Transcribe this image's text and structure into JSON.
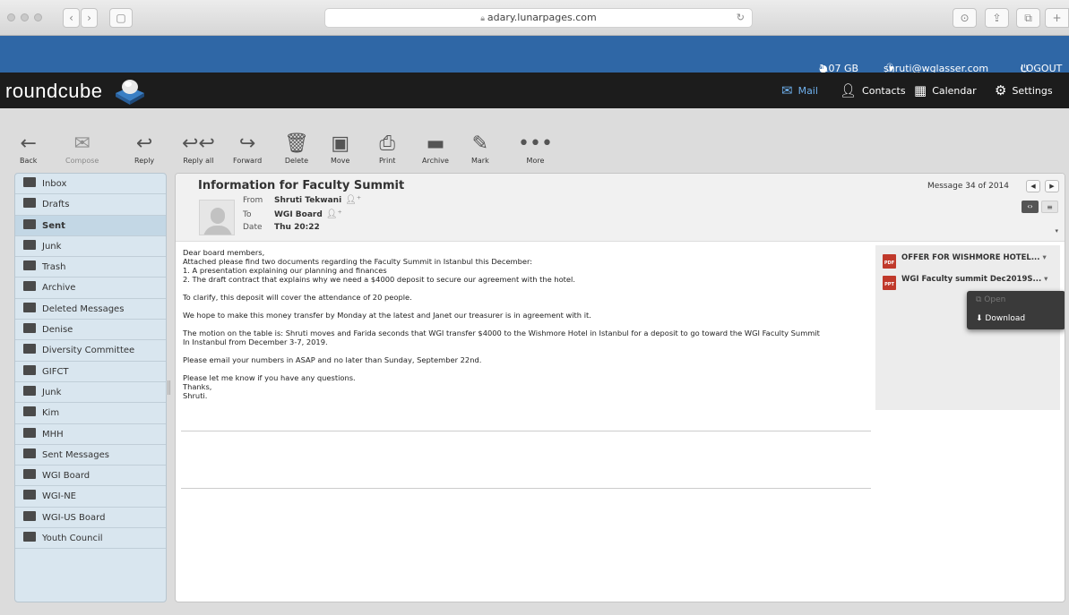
{
  "browser": {
    "address": "adary.lunarpages.com"
  },
  "topbar": {
    "quota": "1.07 GB",
    "user": "shruti@wglasser.com",
    "user_caret": "▾",
    "logout": "LOGOUT"
  },
  "app": {
    "logo": "roundcube",
    "nav": [
      {
        "label": "Mail",
        "icon": "mail-icon"
      },
      {
        "label": "Contacts",
        "icon": "contacts-icon"
      },
      {
        "label": "Calendar",
        "icon": "calendar-icon"
      },
      {
        "label": "Settings",
        "icon": "gear-icon"
      }
    ]
  },
  "toolbar": {
    "back": "Back",
    "compose": "Compose",
    "reply": "Reply",
    "reply_all": "Reply all",
    "forward": "Forward",
    "delete": "Delete",
    "move": "Move",
    "print": "Print",
    "archive": "Archive",
    "mark": "Mark",
    "more": "More"
  },
  "folders": [
    {
      "name": "Inbox",
      "icon": "inbox-icon"
    },
    {
      "name": "Drafts",
      "icon": "pencil-icon"
    },
    {
      "name": "Sent",
      "icon": "sent-icon",
      "selected": true
    },
    {
      "name": "Junk",
      "icon": "junk-icon"
    },
    {
      "name": "Trash",
      "icon": "trash-icon"
    },
    {
      "name": "Archive",
      "icon": "archive-icon"
    },
    {
      "name": "Deleted Messages",
      "icon": "folder-icon"
    },
    {
      "name": "Denise",
      "icon": "folder-icon"
    },
    {
      "name": "Diversity Committee",
      "icon": "folder-icon"
    },
    {
      "name": "GIFCT",
      "icon": "folder-icon"
    },
    {
      "name": "Junk",
      "icon": "folder-icon"
    },
    {
      "name": "Kim",
      "icon": "folder-icon"
    },
    {
      "name": "MHH",
      "icon": "folder-icon"
    },
    {
      "name": "Sent Messages",
      "icon": "folder-icon"
    },
    {
      "name": "WGI Board",
      "icon": "folder-icon"
    },
    {
      "name": "WGI-NE",
      "icon": "folder-icon"
    },
    {
      "name": "WGI-US Board",
      "icon": "folder-icon"
    },
    {
      "name": "Youth Council",
      "icon": "folder-icon"
    }
  ],
  "message": {
    "subject": "Information for Faculty Summit",
    "from_label": "From",
    "from": "Shruti Tekwani",
    "to_label": "To",
    "to": "WGI Board",
    "date_label": "Date",
    "date": "Thu 20:22",
    "counter": "Message 34 of 2014",
    "body": "Dear board members,\nAttached please find two documents regarding the Faculty Summit in Istanbul this December:\n1. A presentation explaining our planning and finances\n2. The draft contract that explains why we need a $4000 deposit to secure our agreement with the hotel.\n\nTo clarify, this deposit will cover the attendance of 20 people.\n\nWe hope to make this money transfer by Monday at the latest and Janet our treasurer is in agreement with it.\n\nThe motion on the table is: Shruti moves and Farida seconds that WGI transfer $4000 to the Wishmore Hotel in Istanbul for a deposit to go toward the WGI Faculty Summit\nIn Instanbul from December 3-7, 2019.\n\nPlease email your numbers in ASAP and no later than Sunday, September 22nd.\n\nPlease let me know if you have any questions.\nThanks,\nShruti."
  },
  "attachments": [
    {
      "name": "OFFER FOR WISHMORE HOTEL...",
      "type": "PDF",
      "color": "#c0392b"
    },
    {
      "name": "WGI Faculty summit Dec2019S...",
      "type": "PPT",
      "color": "#c0392b"
    }
  ],
  "attachment_menu": {
    "open": "Open",
    "download": "Download"
  },
  "colors": {
    "topbar": "#2f67a6",
    "header": "#1c1c1c",
    "active_nav": "#6fb1ee"
  }
}
